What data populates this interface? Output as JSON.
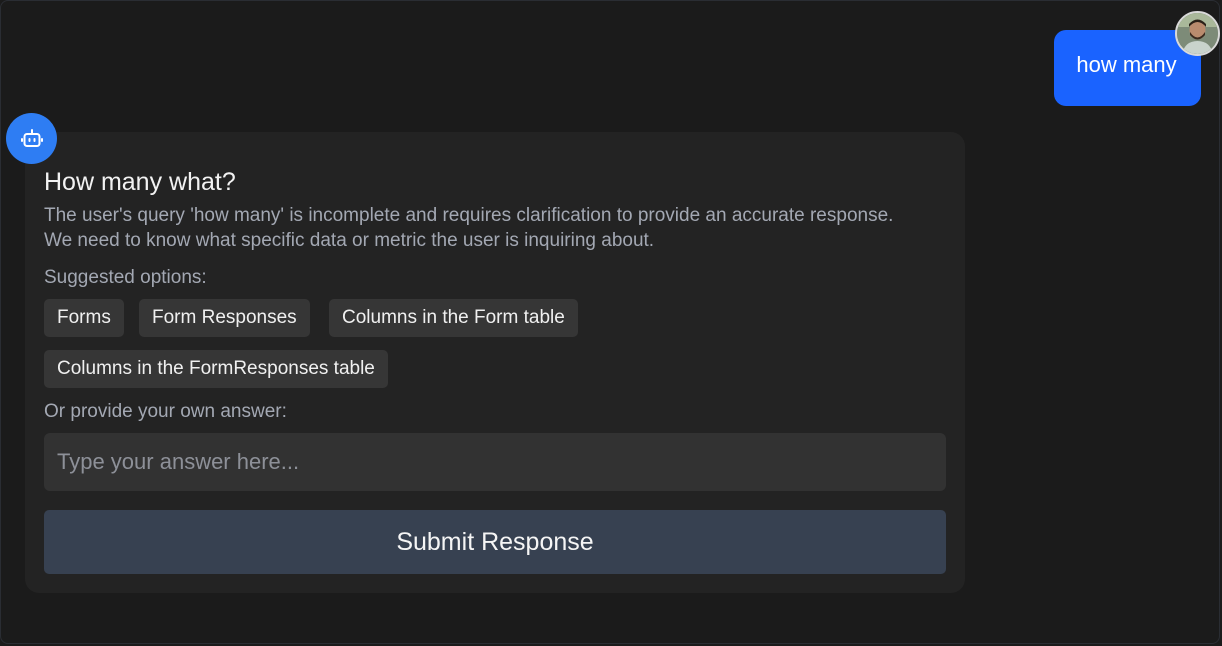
{
  "user_message": {
    "text": "how many",
    "accent_color": "#1a63ff"
  },
  "bot": {
    "avatar_icon": "robot-icon",
    "accent_color": "#2e7df3"
  },
  "clarification": {
    "title": "How many what?",
    "description": "The user's query 'how many' is incomplete and requires clarification to provide an accurate response. We need to know what specific data or metric the user is inquiring about.",
    "suggested_label": "Suggested options:",
    "options": [
      "Forms",
      "Form Responses",
      "Columns in the Form table",
      "Columns in the FormResponses table"
    ],
    "own_answer_label": "Or provide your own answer:",
    "input_placeholder": "Type your answer here...",
    "submit_label": "Submit Response"
  }
}
